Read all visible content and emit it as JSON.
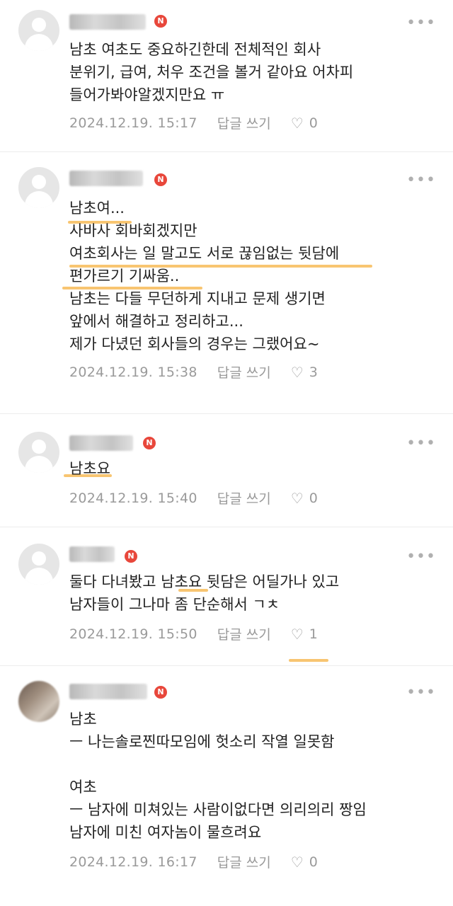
{
  "comments": [
    {
      "text": "남초 여초도 중요하긴한데 전체적인 회사\n분위기, 급여, 처우 조건을 볼거 같아요 어차피\n들어가봐야알겠지만요 ㅠ",
      "date": "2024.12.19. 15:17",
      "reply_label": "답글 쓰기",
      "likes": "0"
    },
    {
      "text": "남초여...\n사바사 회바회겠지만\n여초회사는 일 말고도 서로 끊임없는 뒷담에\n편가르기 기싸움..\n남초는 다들 무던하게 지내고 문제 생기면\n앞에서 해결하고 정리하고...\n제가 다녔던 회사들의 경우는 그랬어요~",
      "date": "2024.12.19. 15:38",
      "reply_label": "답글 쓰기",
      "likes": "3"
    },
    {
      "text": "남초요",
      "date": "2024.12.19. 15:40",
      "reply_label": "답글 쓰기",
      "likes": "0"
    },
    {
      "text": "둘다 다녀봤고 남초요 뒷담은 어딜가나 있고\n남자들이 그나마 좀 단순해서 ㄱㅊ",
      "date": "2024.12.19. 15:50",
      "reply_label": "답글 쓰기",
      "likes": "1"
    },
    {
      "text": "남초\nㅡ 나는솔로찐따모임에 헛소리 작열 일못함\n\n여초\nㅡ 남자에 미쳐있는 사람이없다면 의리의리 짱임\n남자에 미친 여자놈이 물흐려요",
      "date": "2024.12.19. 16:17",
      "reply_label": "답글 쓰기",
      "likes": "0"
    }
  ],
  "badge_letter": "N",
  "more_glyph": "•••",
  "heart_glyph": "♡",
  "colors": {
    "badge": "#e8473b",
    "highlight": "#f5b242",
    "meta_text": "#9a9a9a"
  }
}
